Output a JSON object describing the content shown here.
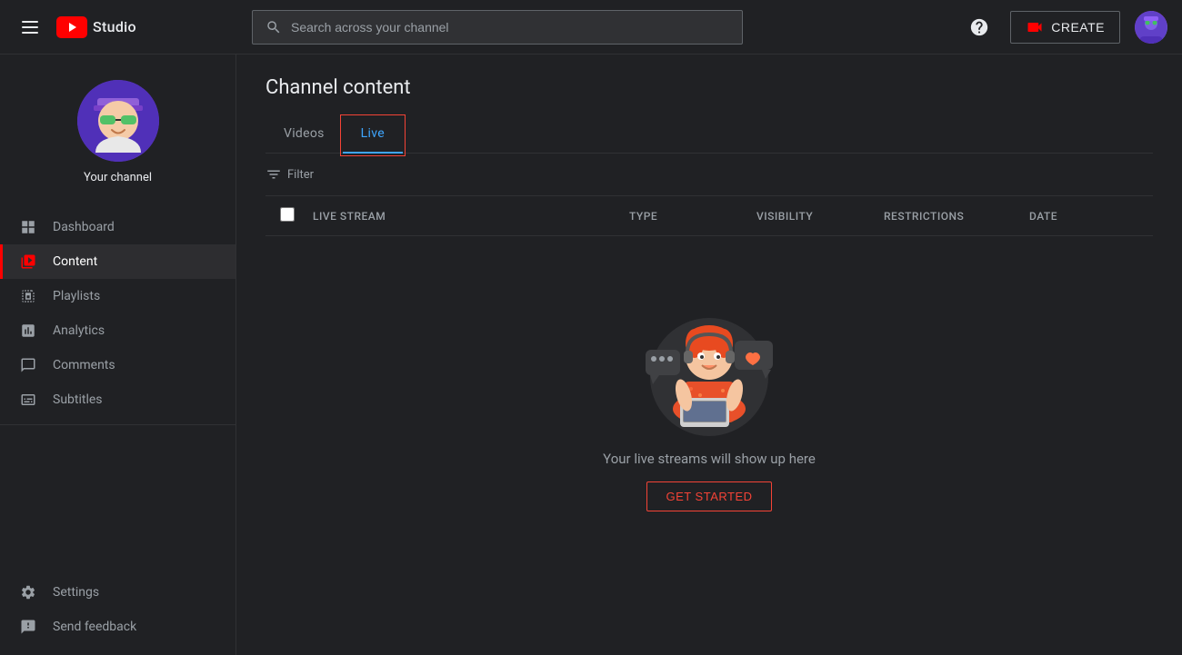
{
  "app": {
    "title": "YouTube Studio",
    "logo_text": "Studio"
  },
  "header": {
    "search_placeholder": "Search across your channel",
    "help_icon": "question-mark",
    "create_label": "CREATE",
    "create_icon": "video-camera-icon"
  },
  "sidebar": {
    "channel_name": "Your channel",
    "nav_items": [
      {
        "id": "dashboard",
        "label": "Dashboard",
        "icon": "grid-icon",
        "active": false
      },
      {
        "id": "content",
        "label": "Content",
        "icon": "content-icon",
        "active": true
      },
      {
        "id": "playlists",
        "label": "Playlists",
        "icon": "playlists-icon",
        "active": false
      },
      {
        "id": "analytics",
        "label": "Analytics",
        "icon": "analytics-icon",
        "active": false
      },
      {
        "id": "comments",
        "label": "Comments",
        "icon": "comments-icon",
        "active": false
      },
      {
        "id": "subtitles",
        "label": "Subtitles",
        "icon": "subtitles-icon",
        "active": false
      }
    ],
    "bottom_items": [
      {
        "id": "settings",
        "label": "Settings",
        "icon": "gear-icon"
      },
      {
        "id": "feedback",
        "label": "Send feedback",
        "icon": "feedback-icon"
      }
    ]
  },
  "content": {
    "page_title": "Channel content",
    "tabs": [
      {
        "id": "videos",
        "label": "Videos",
        "active": false
      },
      {
        "id": "live",
        "label": "Live",
        "active": true
      }
    ],
    "filter_label": "Filter",
    "table": {
      "columns": [
        {
          "id": "stream",
          "label": "Live stream"
        },
        {
          "id": "type",
          "label": "Type"
        },
        {
          "id": "visibility",
          "label": "Visibility"
        },
        {
          "id": "restrictions",
          "label": "Restrictions"
        },
        {
          "id": "date",
          "label": "Date"
        }
      ]
    },
    "empty_state": {
      "text": "Your live streams will show up here",
      "cta_label": "GET STARTED"
    }
  }
}
